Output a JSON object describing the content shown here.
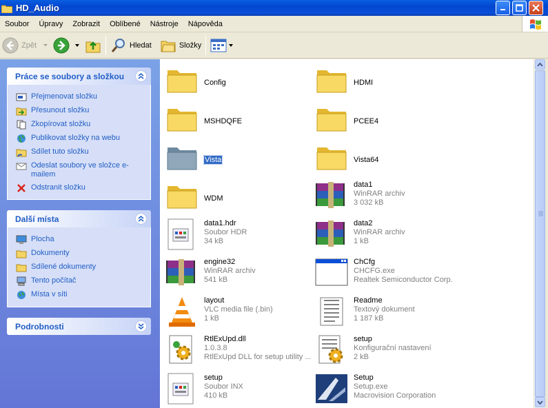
{
  "window": {
    "title": "HD_Audio"
  },
  "menu": [
    "Soubor",
    "Úpravy",
    "Zobrazit",
    "Oblíbené",
    "Nástroje",
    "Nápověda"
  ],
  "toolbar": {
    "back": "Zpět",
    "search": "Hledat",
    "folders": "Složky"
  },
  "tasks": {
    "title": "Práce se soubory a složkou",
    "items": [
      "Přejmenovat složku",
      "Přesunout složku",
      "Zkopírovat složku",
      "Publikovat složky na webu",
      "Sdílet tuto složku",
      "Odeslat soubory ve složce e-mailem",
      "Odstranit složku"
    ]
  },
  "places": {
    "title": "Další místa",
    "items": [
      "Plocha",
      "Dokumenty",
      "Sdílené dokumenty",
      "Tento počítač",
      "Místa v síti"
    ]
  },
  "details": {
    "title": "Podrobnosti"
  },
  "files": [
    {
      "name": "Config",
      "type": "folder"
    },
    {
      "name": "HDMI",
      "type": "folder"
    },
    {
      "name": "MSHDQFE",
      "type": "folder"
    },
    {
      "name": "PCEE4",
      "type": "folder"
    },
    {
      "name": "Vista",
      "type": "folder-selected"
    },
    {
      "name": "Vista64",
      "type": "folder"
    },
    {
      "name": "WDM",
      "type": "folder"
    },
    {
      "name": "data1",
      "type": "rar",
      "l2": "WinRAR archiv",
      "l3": "3 032 kB"
    },
    {
      "name": "data1.hdr",
      "type": "doc",
      "l2": "Soubor HDR",
      "l3": "34 kB"
    },
    {
      "name": "data2",
      "type": "rar",
      "l2": "WinRAR archiv",
      "l3": "1 kB"
    },
    {
      "name": "engine32",
      "type": "rar",
      "l2": "WinRAR archiv",
      "l3": "541 kB"
    },
    {
      "name": "ChCfg",
      "type": "exe",
      "l2": "CHCFG.exe",
      "l3": "Realtek Semiconductor Corp."
    },
    {
      "name": "layout",
      "type": "vlc",
      "l2": "VLC media file (.bin)",
      "l3": "1 kB"
    },
    {
      "name": "Readme",
      "type": "txt",
      "l2": "Textový dokument",
      "l3": "1 187 kB"
    },
    {
      "name": "RtlExUpd.dll",
      "type": "dll",
      "l2": "1.0.3.8",
      "l3": "RtlExUpd DLL for setup utility ..."
    },
    {
      "name": "setup",
      "type": "ini",
      "l2": "Konfigurační nastavení",
      "l3": "2 kB"
    },
    {
      "name": "setup",
      "type": "doc",
      "l2": "Soubor INX",
      "l3": "410 kB"
    },
    {
      "name": "Setup",
      "type": "setup",
      "l2": "Setup.exe",
      "l3": "Macrovision Corporation"
    }
  ]
}
